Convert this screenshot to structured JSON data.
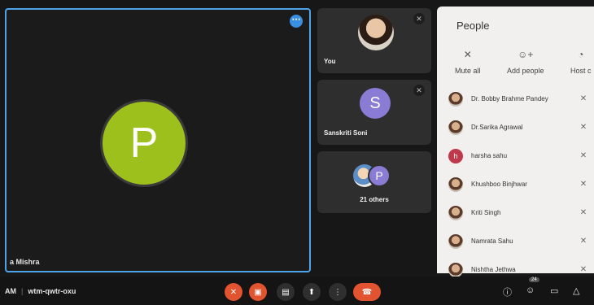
{
  "main_tile": {
    "avatar_letter": "P",
    "name": "a Mishra"
  },
  "tiles": {
    "you": {
      "label": "You"
    },
    "sanskriti": {
      "label": "Sanskriti Soni",
      "avatar_letter": "S"
    },
    "others": {
      "label": "21 others",
      "avatar_letter": "P"
    }
  },
  "people_panel": {
    "title": "People",
    "actions": {
      "mute_all": "Mute all",
      "add_people": "Add people",
      "host_controls": "Host c"
    },
    "participants": [
      {
        "name": "Dr. Bobby Brahme Pandey",
        "avatar": "photo"
      },
      {
        "name": "Dr.Sarika Agrawal",
        "avatar": "photo"
      },
      {
        "name": "harsha sahu",
        "avatar": "h"
      },
      {
        "name": "Khushboo Binjhwar",
        "avatar": "photo"
      },
      {
        "name": "Kriti Singh",
        "avatar": "photo"
      },
      {
        "name": "Namrata Sahu",
        "avatar": "photo"
      },
      {
        "name": "Nishtha Jethwa",
        "avatar": "photo"
      }
    ]
  },
  "bottom_bar": {
    "time": "AM",
    "meeting_code": "wtm-qwtr-oxu",
    "people_count": "24",
    "accent_red": "#e2532f"
  }
}
